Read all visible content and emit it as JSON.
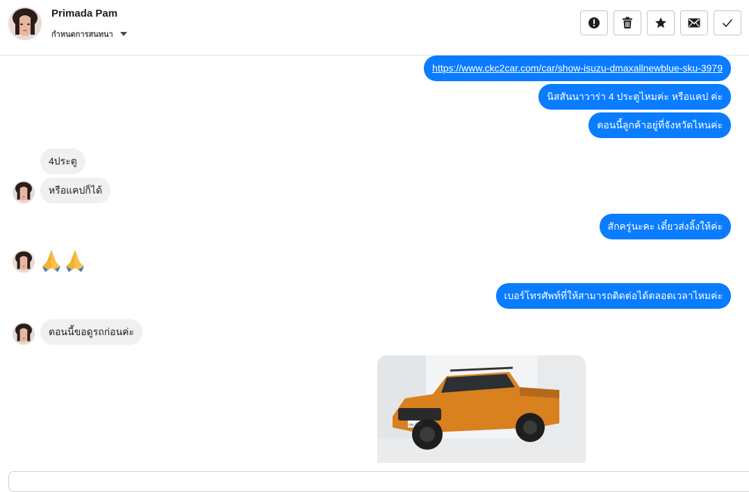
{
  "contact": {
    "name": "Primada Pam",
    "label_dropdown": "กำหนดการสนทนา"
  },
  "toolbar": [
    {
      "name": "report-spam-button",
      "icon": "exclamation-icon"
    },
    {
      "name": "delete-button",
      "icon": "trash-icon"
    },
    {
      "name": "star-button",
      "icon": "star-icon"
    },
    {
      "name": "mark-unread-button",
      "icon": "envelope-icon"
    },
    {
      "name": "mark-done-button",
      "icon": "check-icon"
    }
  ],
  "messages": {
    "out_1": "https://www.ckc2car.com/car/show-isuzu-dmaxallnewblue-sku-3979",
    "out_2": "นิสสันนาวาร่า 4 ประตูไหมค่ะ หรือแคป ค่ะ",
    "out_3": "ตอนนี้ลูกค้าอยู่ที่จังหวัดไหนค่ะ",
    "in_1": "4ประตู",
    "in_2": "หรือแคปก็ได้",
    "out_4": "สักครู่นะคะ เดี๋ยวส่งลิ้งให้ค่ะ",
    "in_3": "🙏🙏",
    "out_5": "เบอร์โทรศัพท์ที่ให้สามารถติดต่อได้ตลอดเวลาไหมค่ะ",
    "in_4": "ตอนนี้ขอดูรถก่อนค่ะ"
  },
  "car_image": {
    "plate": "กข 889"
  },
  "colors": {
    "outgoing": "#0a7cff",
    "incoming": "#f0f0f0",
    "car": "#d9801f"
  }
}
